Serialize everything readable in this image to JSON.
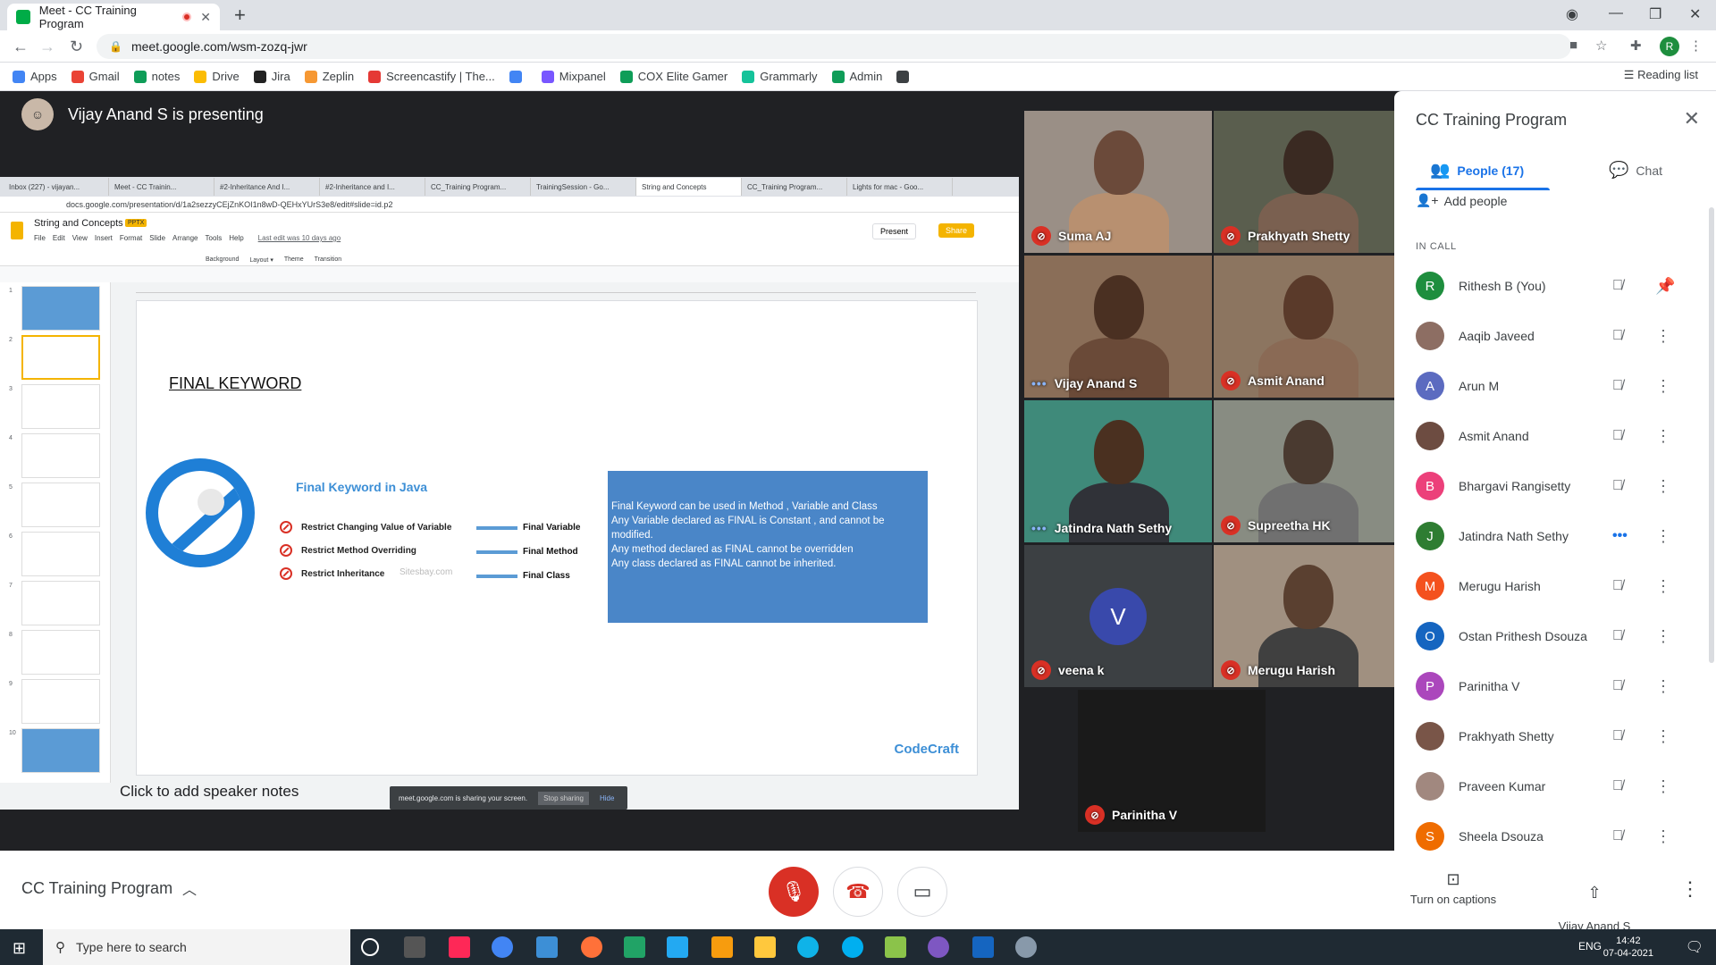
{
  "browser": {
    "tab_title": "Meet - CC Training Program",
    "url": "meet.google.com/wsm-zozq-jwr",
    "bookmarks": [
      {
        "label": "Apps",
        "color": "#4285f4"
      },
      {
        "label": "Gmail",
        "color": "#ea4335"
      },
      {
        "label": "notes",
        "color": "#0f9d58"
      },
      {
        "label": "Drive",
        "color": "#fbbc04"
      },
      {
        "label": "Jira",
        "color": "#222222"
      },
      {
        "label": "Zeplin",
        "color": "#f69833"
      },
      {
        "label": "Screencastify | The...",
        "color": "#e53935"
      },
      {
        "label": "",
        "color": "#4285f4"
      },
      {
        "label": "Mixpanel",
        "color": "#7856ff"
      },
      {
        "label": "COX Elite Gamer",
        "color": "#0f9d58"
      },
      {
        "label": "Grammarly",
        "color": "#15c39a"
      },
      {
        "label": "Admin",
        "color": "#0f9d58"
      },
      {
        "label": "",
        "color": "#3c4043"
      }
    ],
    "reading_list": "Reading list",
    "profile_initial": "R"
  },
  "meet": {
    "presenter_banner": "Vijay Anand S is presenting",
    "meeting_name": "CC Training Program"
  },
  "shared_screen": {
    "tabs": [
      "Inbox (227) - vijayan...",
      "Meet - CC Trainin...",
      "#2-Inheritance And I...",
      "#2-Inheritance and I...",
      "CC_Training Program...",
      "TrainingSession - Go...",
      "String and Concepts",
      "CC_Training Program...",
      "Lights for mac - Goo..."
    ],
    "url": "docs.google.com/presentation/d/1a2sezzyCEjZnKOI1n8wD-QEHxYUrS3e8/edit#slide=id.p2",
    "doc_title": "String and Concepts",
    "doc_badge": "PPTX",
    "menu": [
      "File",
      "Edit",
      "View",
      "Insert",
      "Format",
      "Slide",
      "Arrange",
      "Tools",
      "Help"
    ],
    "last_edit": "Last edit was 10 days ago",
    "present_label": "Present",
    "share_label": "Share",
    "toolbar": [
      "Background",
      "Layout ▾",
      "Theme",
      "Transition"
    ],
    "slide": {
      "title": "FINAL KEYWORD",
      "heading": "Final Keyword in Java",
      "rows": [
        {
          "left": "Restrict Changing Value of Variable",
          "right": "Final Variable"
        },
        {
          "left": "Restrict  Method Overriding",
          "right": "Final Method"
        },
        {
          "left": "Restrict  Inheritance",
          "right": "Final Class"
        }
      ],
      "watermark": "Sitesbay.com",
      "box_lines": [
        "Final Keyword can be used in Method , Variable and Class",
        "Any Variable declared as FINAL is Constant , and cannot be modified.",
        "Any method declared as FINAL cannot be overridden",
        "Any class declared as FINAL cannot be inherited."
      ],
      "brand": "CodeCraft"
    },
    "speaker_notes": "Click to add speaker notes",
    "sharing_text": "meet.google.com is sharing your screen.",
    "stop_sharing": "Stop sharing",
    "hide": "Hide",
    "thumb_numbers": [
      "1",
      "2",
      "3",
      "4",
      "5",
      "6",
      "7",
      "8",
      "9",
      "10"
    ]
  },
  "tiles": [
    {
      "name": "Suma AJ",
      "state": "muted"
    },
    {
      "name": "Prakhyath Shetty",
      "state": "muted"
    },
    {
      "name": "Vijay Anand S",
      "state": "speaking"
    },
    {
      "name": "Asmit Anand",
      "state": "muted"
    },
    {
      "name": "Jatindra Nath Sethy",
      "state": "speaking"
    },
    {
      "name": "Supreetha HK",
      "state": "muted"
    },
    {
      "name": "veena k",
      "state": "muted",
      "avatar_letter": "V"
    },
    {
      "name": "Merugu Harish",
      "state": "muted"
    },
    {
      "name": "Parinitha V",
      "state": "muted"
    }
  ],
  "panel": {
    "title": "CC Training Program",
    "people_tab": "People (17)",
    "chat_tab": "Chat",
    "add_people": "Add people",
    "in_call": "IN CALL",
    "participants": [
      {
        "name": "Rithesh B (You)",
        "initial": "R",
        "color": "#1e8e3e",
        "mic": "muted"
      },
      {
        "name": "Aaqib Javeed",
        "initial": "",
        "color": "#8d6e63",
        "mic": "muted"
      },
      {
        "name": "Arun M",
        "initial": "A",
        "color": "#5c6bc0",
        "mic": "muted"
      },
      {
        "name": "Asmit Anand",
        "initial": "",
        "color": "#6d4c41",
        "mic": "muted"
      },
      {
        "name": "Bhargavi Rangisetty",
        "initial": "B",
        "color": "#ec407a",
        "mic": "muted"
      },
      {
        "name": "Jatindra Nath Sethy",
        "initial": "J",
        "color": "#2e7d32",
        "mic": "speaking"
      },
      {
        "name": "Merugu Harish",
        "initial": "M",
        "color": "#f4511e",
        "mic": "muted"
      },
      {
        "name": "Ostan Prithesh Dsouza",
        "initial": "O",
        "color": "#1565c0",
        "mic": "muted"
      },
      {
        "name": "Parinitha V",
        "initial": "P",
        "color": "#ab47bc",
        "mic": "muted"
      },
      {
        "name": "Prakhyath Shetty",
        "initial": "",
        "color": "#795548",
        "mic": "muted"
      },
      {
        "name": "Praveen Kumar",
        "initial": "",
        "color": "#a1887f",
        "mic": "muted"
      },
      {
        "name": "Sheela Dsouza",
        "initial": "S",
        "color": "#ef6c00",
        "mic": "muted"
      }
    ]
  },
  "bottombar": {
    "captions": "Turn on captions",
    "presenting": "Vijay Anand S\nis presenting"
  },
  "taskbar": {
    "search_placeholder": "Type here to search",
    "time": "14:42",
    "date": "07-04-2021",
    "lang": "ENG"
  }
}
